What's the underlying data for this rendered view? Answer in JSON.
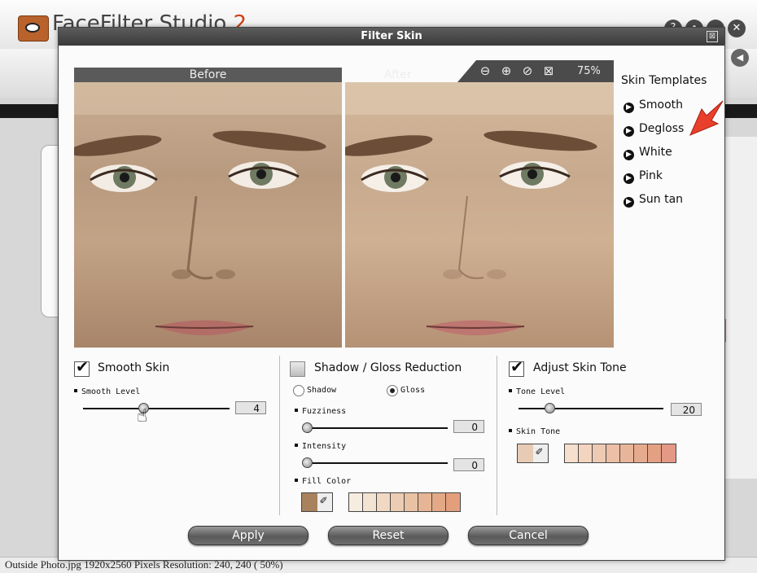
{
  "app": {
    "title": "FaceFilter Studio",
    "version": "2",
    "status_file": "Outside Photo.jpg   1920x2560 Pixels   Resolution: 240, 240 ( 50%)"
  },
  "dialog": {
    "title": "Filter Skin",
    "close_glyph": "⊠"
  },
  "preview": {
    "before_label": "Before",
    "after_label": "After",
    "zoom_out_icon": "⊖",
    "zoom_in_icon": "⊕",
    "reset_zoom_icon": "⊘",
    "fit_icon": "⊠",
    "zoom_level": "75%"
  },
  "templates": {
    "title": "Skin Templates",
    "items": [
      {
        "label": "Smooth"
      },
      {
        "label": "Degloss"
      },
      {
        "label": "White"
      },
      {
        "label": "Pink"
      },
      {
        "label": "Sun tan"
      }
    ]
  },
  "smooth_skin": {
    "title": "Smooth Skin",
    "checked": true,
    "level_label": "Smooth Level",
    "level_value": "4",
    "level_fraction": 0.4
  },
  "shadow_gloss": {
    "title": "Shadow / Gloss Reduction",
    "checked": false,
    "radio_shadow": "Shadow",
    "radio_gloss": "Gloss",
    "selected": "Gloss",
    "fuzziness_label": "Fuzziness",
    "fuzziness_value": "0",
    "intensity_label": "Intensity",
    "intensity_value": "0",
    "fill_color_label": "Fill Color",
    "fill_current_color": "#a8825d",
    "palette": [
      "#f6ece0",
      "#f3e3d2",
      "#f0d8c2",
      "#ecccb2",
      "#e9c1a3",
      "#e6b595",
      "#e3a987",
      "#e39f7c"
    ]
  },
  "skin_tone": {
    "title": "Adjust Skin Tone",
    "checked": true,
    "tone_label": "Tone Level",
    "tone_value": "20",
    "skin_tone_label": "Skin Tone",
    "current_color": "#e8cbb4",
    "palette": [
      "#f6dfcc",
      "#f3d5bf",
      "#efcab3",
      "#ecbfa6",
      "#e9b59a",
      "#e6aa8e",
      "#e3a083",
      "#e49886"
    ]
  },
  "buttons": {
    "apply": "Apply",
    "reset": "Reset",
    "cancel": "Cancel"
  }
}
